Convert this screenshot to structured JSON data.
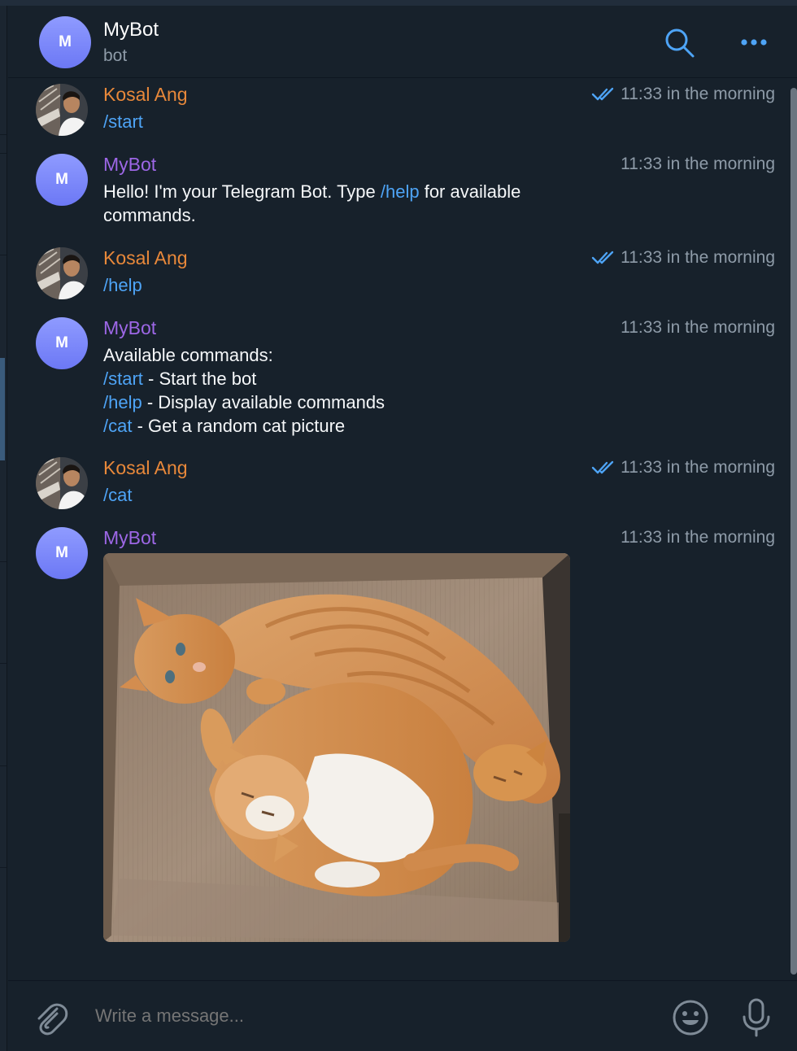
{
  "colors": {
    "background": "#17212b",
    "accent": "#4ea4f6",
    "user_name": "#e8883a",
    "bot_name": "#9d67e6",
    "timestamp": "#8e9ba8"
  },
  "header": {
    "avatar_letter": "M",
    "title": "MyBot",
    "subtitle": "bot",
    "icons": [
      "search-icon",
      "more-icon"
    ]
  },
  "messages": [
    {
      "sender": "Kosal Ang",
      "time": "11:33 in the morning",
      "read": true,
      "lines": [
        [
          {
            "text": "/start",
            "cmd": true
          }
        ]
      ]
    },
    {
      "sender": "MyBot",
      "time": "11:33 in the morning",
      "lines": [
        [
          {
            "text": "Hello! I'm your Telegram Bot. Type "
          },
          {
            "text": "/help",
            "cmd": true
          },
          {
            "text": " for available"
          }
        ],
        [
          {
            "text": "commands."
          }
        ]
      ]
    },
    {
      "sender": "Kosal Ang",
      "time": "11:33 in the morning",
      "read": true,
      "lines": [
        [
          {
            "text": "/help",
            "cmd": true
          }
        ]
      ]
    },
    {
      "sender": "MyBot",
      "time": "11:33 in the morning",
      "lines": [
        [
          {
            "text": "Available commands:"
          }
        ],
        [
          {
            "text": "/start",
            "cmd": true
          },
          {
            "text": " - Start the bot"
          }
        ],
        [
          {
            "text": "/help",
            "cmd": true
          },
          {
            "text": " - Display available commands"
          }
        ],
        [
          {
            "text": "/cat",
            "cmd": true
          },
          {
            "text": " - Get a random cat picture"
          }
        ]
      ]
    },
    {
      "sender": "Kosal Ang",
      "time": "11:33 in the morning",
      "read": true,
      "lines": [
        [
          {
            "text": "/cat",
            "cmd": true
          }
        ]
      ]
    },
    {
      "sender": "MyBot",
      "time": "11:33 in the morning",
      "image": "kittens-in-box-photo"
    }
  ],
  "composer": {
    "placeholder": "Write a message...",
    "icons": [
      "paperclip-icon",
      "emoji-icon",
      "microphone-icon"
    ]
  }
}
